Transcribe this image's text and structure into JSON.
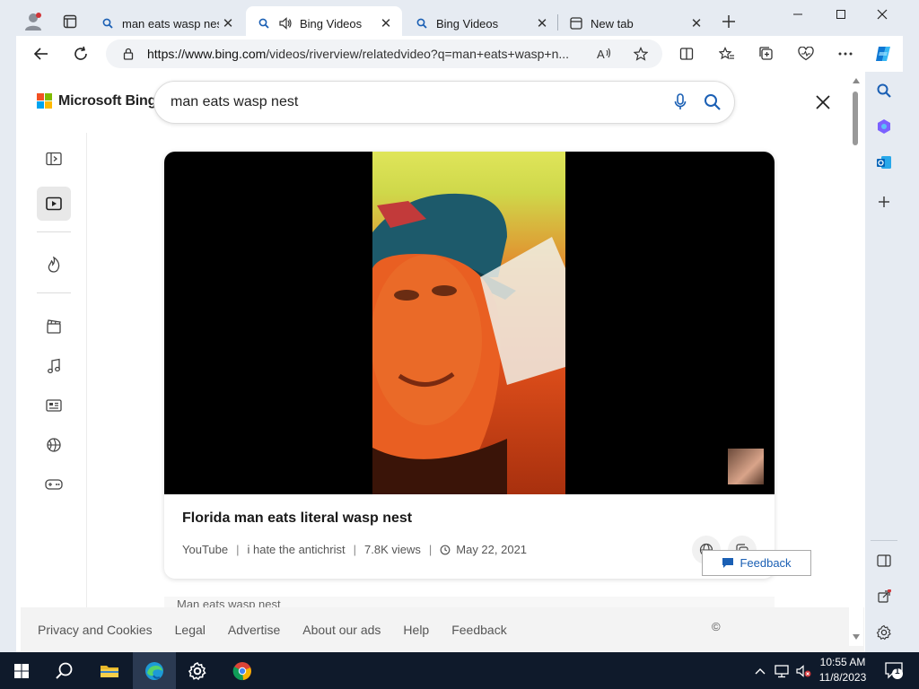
{
  "browser": {
    "tabs": [
      {
        "label": "man eats wasp nest",
        "icon": "search-icon"
      },
      {
        "label": "Bing Videos",
        "icon": "search-icon",
        "audio": true
      },
      {
        "label": "Bing Videos",
        "icon": "search-icon"
      },
      {
        "label": "New tab",
        "icon": "new-tab-icon"
      }
    ],
    "url_host": "https://www.bing.com",
    "url_path": "/videos/riverview/relatedvideo?q=man+eats+wasp+n..."
  },
  "bing": {
    "brand": "Microsoft Bing",
    "search_query": "man eats wasp nest",
    "video": {
      "title": "Florida man eats literal wasp nest",
      "source": "YouTube",
      "channel": "i hate the antichrist",
      "views": "7.8K views",
      "date": "May 22, 2021"
    },
    "next_item_label": "Man eats wasp nest",
    "footer_links": [
      "Privacy and Cookies",
      "Legal",
      "Advertise",
      "About our ads",
      "Help",
      "Feedback"
    ],
    "footer_copy": "©",
    "feedback_button": "Feedback"
  },
  "taskbar": {
    "time": "10:55 AM",
    "date": "11/8/2023",
    "notification_count": "1"
  },
  "colors": {
    "ms_red": "#f25022",
    "ms_green": "#7fba00",
    "ms_blue": "#00a4ef",
    "ms_yellow": "#ffb900",
    "bing_blue": "#1a5fb4"
  }
}
